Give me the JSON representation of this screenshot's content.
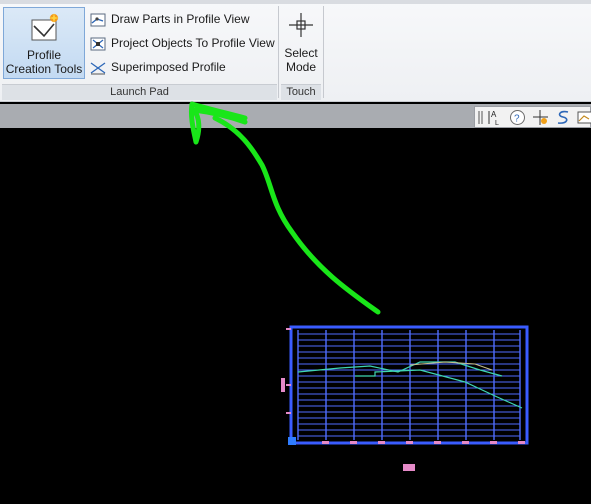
{
  "ribbon": {
    "profile_creation_tools": "Profile\nCreation Tools",
    "draw_parts_label": "Draw Parts in Profile View",
    "project_objects_label": "Project Objects To Profile View",
    "superimposed_label": "Superimposed Profile",
    "launch_pad_label": "Launch Pad",
    "select_mode_label": "Select\nMode",
    "touch_label": "Touch"
  },
  "colors": {
    "annotation_green": "#19e619",
    "profile_blue": "#3a5cff",
    "ribbon_highlight": "#c3daf2"
  }
}
